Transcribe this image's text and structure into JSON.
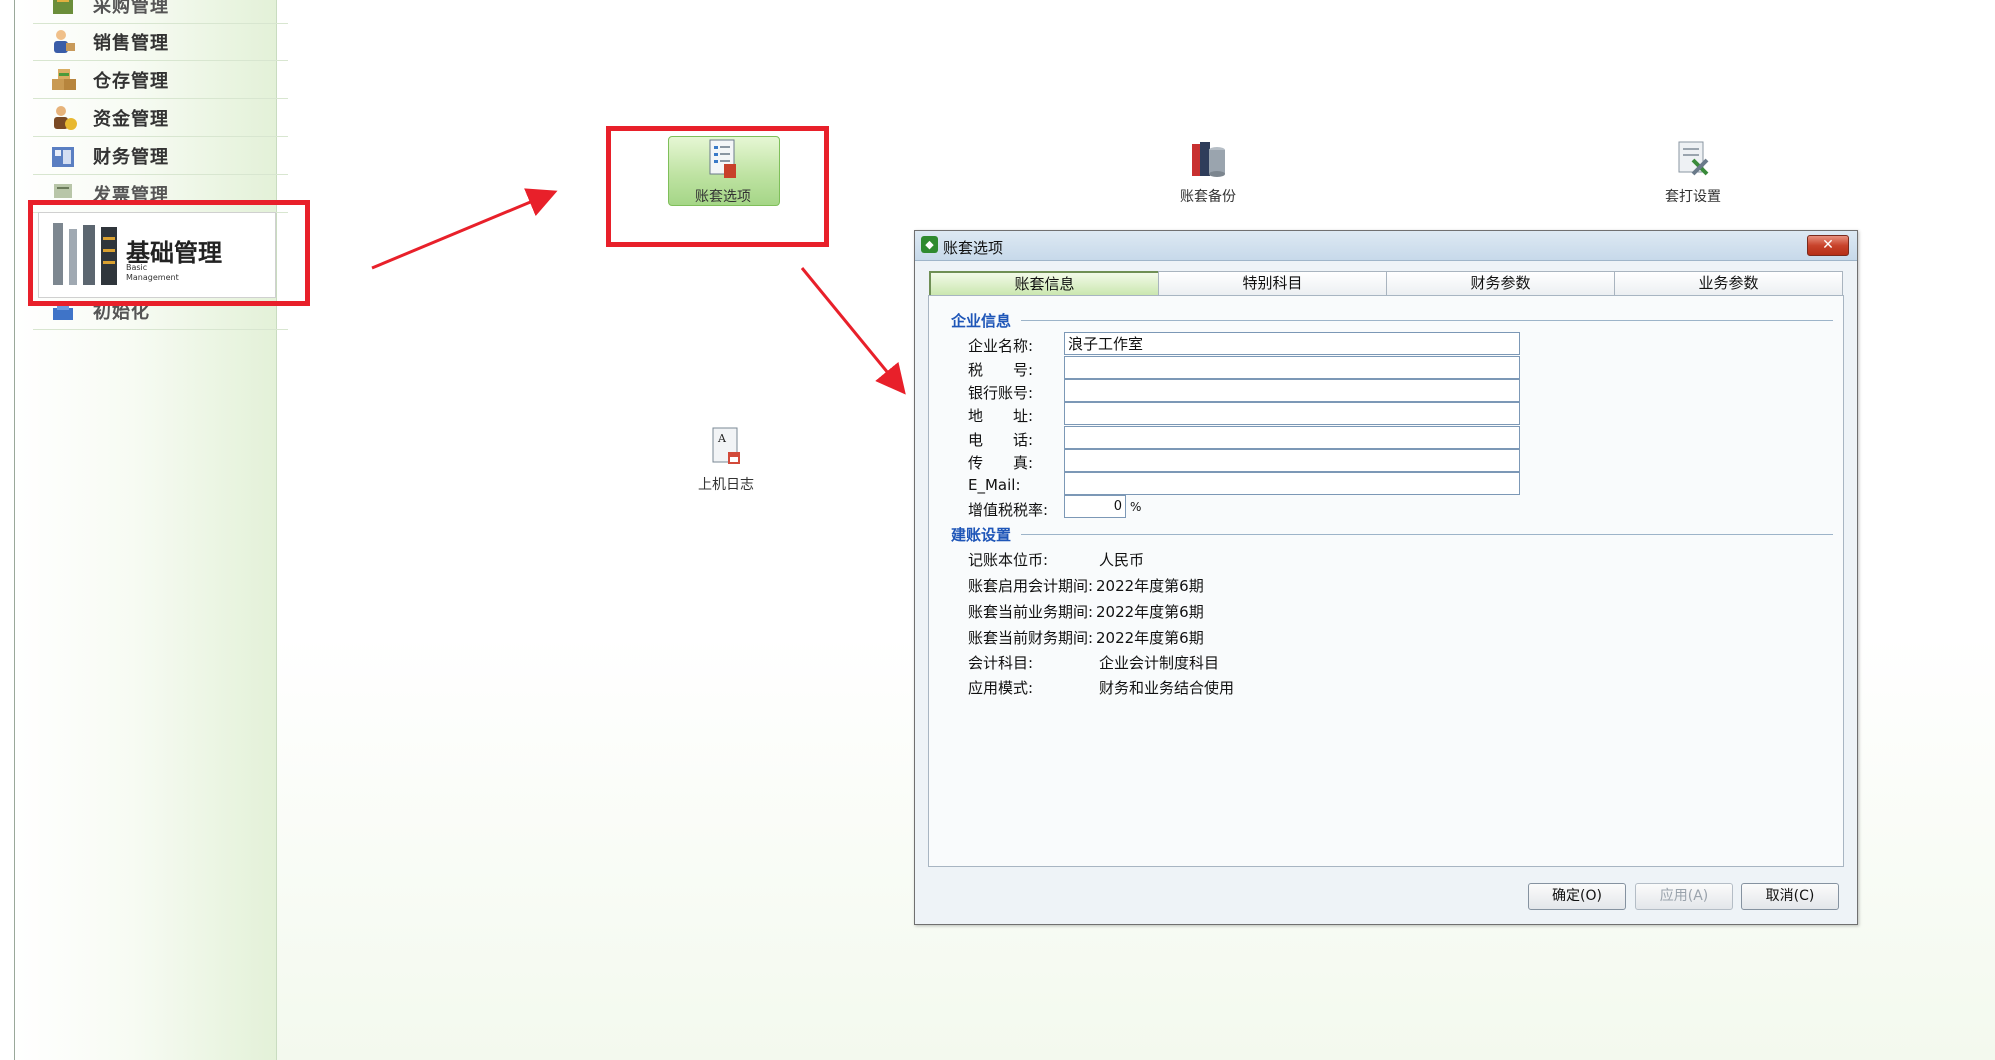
{
  "sidebar": {
    "items": [
      {
        "label": "采购管理"
      },
      {
        "label": "销售管理"
      },
      {
        "label": "仓存管理"
      },
      {
        "label": "资金管理"
      },
      {
        "label": "财务管理"
      },
      {
        "label": "发票管理"
      },
      {
        "label": "初始化"
      }
    ],
    "active": {
      "title": "基础管理",
      "subtitle": "Basic Management"
    }
  },
  "workspace": {
    "tools": [
      {
        "label": "账套选项"
      },
      {
        "label": "账套备份"
      },
      {
        "label": "套打设置"
      },
      {
        "label": "上机日志"
      }
    ]
  },
  "dialog": {
    "title": "账套选项",
    "close": "✕",
    "tabs": [
      "账套信息",
      "特别科目",
      "财务参数",
      "业务参数"
    ],
    "active_tab": "账套信息",
    "company_section": "企业信息",
    "fields": {
      "company_name": {
        "label": "企业名称:",
        "value": "浪子工作室"
      },
      "tax_no": {
        "label": "税　　号:",
        "value": ""
      },
      "bank_account": {
        "label": "银行账号:",
        "value": ""
      },
      "address": {
        "label": "地　　址:",
        "value": ""
      },
      "phone": {
        "label": "电　　话:",
        "value": ""
      },
      "fax": {
        "label": "传　　真:",
        "value": ""
      },
      "email": {
        "label": "E_Mail:",
        "value": ""
      },
      "vat_rate": {
        "label": "增值税税率:",
        "value": "0",
        "unit": "%"
      }
    },
    "setup_section": "建账设置",
    "setup": {
      "currency": {
        "label": "记账本位币:",
        "value": "人民币"
      },
      "start_period": {
        "label": "账套启用会计期间:",
        "value": "2022年度第6期"
      },
      "business_period": {
        "label": "账套当前业务期间:",
        "value": "2022年度第6期"
      },
      "finance_period": {
        "label": "账套当前财务期间:",
        "value": "2022年度第6期"
      },
      "accounts": {
        "label": "会计科目:",
        "value": "企业会计制度科目"
      },
      "mode": {
        "label": "应用模式:",
        "value": "财务和业务结合使用"
      }
    },
    "buttons": {
      "ok": "确定(O)",
      "apply": "应用(A)",
      "cancel": "取消(C)"
    }
  },
  "colors": {
    "annotation_red": "#e8202a",
    "section_blue": "#1f56b8",
    "accent_green": "#a5d687"
  }
}
